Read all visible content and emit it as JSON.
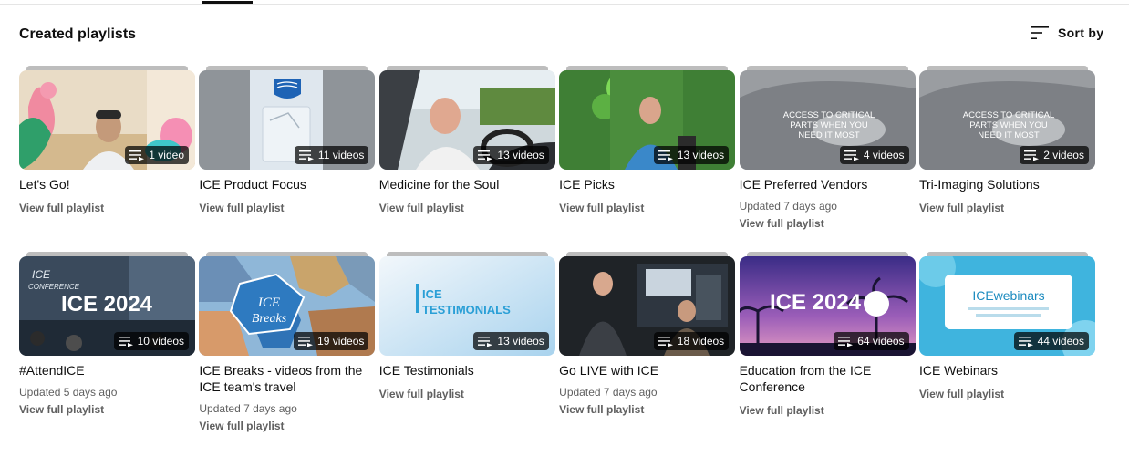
{
  "section": {
    "title": "Created playlists"
  },
  "sort": {
    "label": "Sort by",
    "icon": "sort-icon"
  },
  "badge_icon": "playlist-icon",
  "playlists": [
    {
      "title": "Let's Go!",
      "count": "1 video",
      "updated": "",
      "action": "View full playlist",
      "thumb": "pool-floats"
    },
    {
      "title": "ICE Product Focus",
      "count": "11 videos",
      "updated": "",
      "action": "View full playlist",
      "thumb": "philips-device"
    },
    {
      "title": "Medicine for the Soul",
      "count": "13 videos",
      "updated": "",
      "action": "View full playlist",
      "thumb": "car-driver"
    },
    {
      "title": "ICE Picks",
      "count": "13 videos",
      "updated": "",
      "action": "View full playlist",
      "thumb": "presenter-green"
    },
    {
      "title": "ICE Preferred Vendors",
      "count": "4 videos",
      "updated": "Updated 7 days ago",
      "action": "View full playlist",
      "thumb": "gray-banner",
      "thumb_text": [
        "ACCESS TO CRITICAL",
        "PARTS WHEN YOU",
        "NEED IT MOST"
      ]
    },
    {
      "title": "Tri-Imaging Solutions",
      "count": "2 videos",
      "updated": "",
      "action": "View full playlist",
      "thumb": "gray-banner",
      "thumb_text": [
        "ACCESS TO CRITICAL",
        "PARTS WHEN YOU",
        "NEED IT MOST"
      ]
    },
    {
      "title": "#AttendICE",
      "count": "10 videos",
      "updated": "Updated 5 days ago",
      "action": "View full playlist",
      "thumb": "conference-hall",
      "thumb_text": [
        "ICE 2024",
        "ICE",
        "CONFERENCE"
      ]
    },
    {
      "title": "ICE Breaks - videos from the ICE team's travel",
      "count": "19 videos",
      "updated": "Updated 7 days ago",
      "action": "View full playlist",
      "thumb": "travel-hex",
      "thumb_text": [
        "ICE",
        "Breaks"
      ]
    },
    {
      "title": "ICE Testimonials",
      "count": "13 videos",
      "updated": "",
      "action": "View full playlist",
      "thumb": "testimonials",
      "thumb_text": [
        "ICE",
        "TESTIMONIALS"
      ]
    },
    {
      "title": "Go LIVE with ICE",
      "count": "18 videos",
      "updated": "Updated 7 days ago",
      "action": "View full playlist",
      "thumb": "booth-live"
    },
    {
      "title": "Education from the ICE Conference",
      "count": "64 videos",
      "updated": "",
      "action": "View full playlist",
      "thumb": "palm-sunset",
      "thumb_text": [
        "ICE 2024"
      ]
    },
    {
      "title": "ICE Webinars",
      "count": "44 videos",
      "updated": "",
      "action": "View full playlist",
      "thumb": "webinars",
      "thumb_text": [
        "ICEwebinars"
      ]
    }
  ],
  "colors": {
    "text_primary": "#0f0f0f",
    "text_secondary": "#606060",
    "badge_bg": "#000000b8"
  }
}
